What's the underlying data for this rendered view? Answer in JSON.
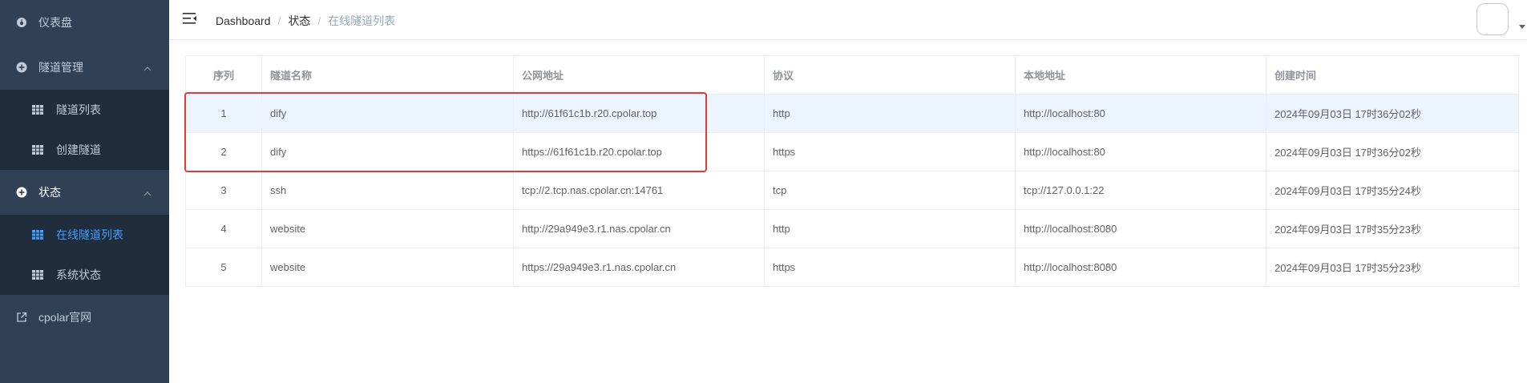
{
  "sidebar": {
    "dashboard": "仪表盘",
    "tunnel_mgmt": "隧道管理",
    "tunnel_list": "隧道列表",
    "create_tunnel": "创建隧道",
    "status": "状态",
    "online_tunnels": "在线隧道列表",
    "system_status": "系统状态",
    "official_site": "cpolar官网"
  },
  "header": {
    "breadcrumb": [
      "Dashboard",
      "状态",
      "在线隧道列表"
    ]
  },
  "table": {
    "columns": [
      "序列",
      "隧道名称",
      "公网地址",
      "协议",
      "本地地址",
      "创建时间"
    ],
    "rows": [
      [
        "1",
        "dify",
        "http://61f61c1b.r20.cpolar.top",
        "http",
        "http://localhost:80",
        "2024年09月03日 17时36分02秒"
      ],
      [
        "2",
        "dify",
        "https://61f61c1b.r20.cpolar.top",
        "https",
        "http://localhost:80",
        "2024年09月03日 17时36分02秒"
      ],
      [
        "3",
        "ssh",
        "tcp://2.tcp.nas.cpolar.cn:14761",
        "tcp",
        "tcp://127.0.0.1:22",
        "2024年09月03日 17时35分24秒"
      ],
      [
        "4",
        "website",
        "http://29a949e3.r1.nas.cpolar.cn",
        "http",
        "http://localhost:8080",
        "2024年09月03日 17时35分23秒"
      ],
      [
        "5",
        "website",
        "https://29a949e3.r1.nas.cpolar.cn",
        "https",
        "http://localhost:8080",
        "2024年09月03日 17时35分23秒"
      ]
    ]
  },
  "colors": {
    "sidebar_bg": "#304156",
    "submenu_bg": "#1f2d3d",
    "active": "#409eff",
    "highlight": "#e53935"
  }
}
